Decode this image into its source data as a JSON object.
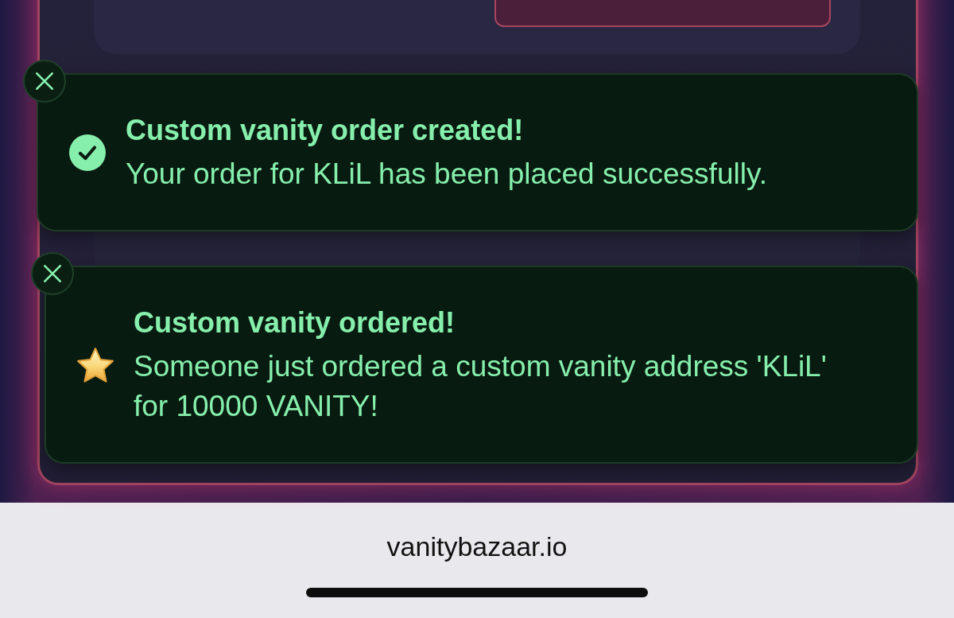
{
  "toasts": [
    {
      "kind": "success",
      "title": "Custom vanity order created!",
      "message": "Your order for KLiL has been placed successfully."
    },
    {
      "kind": "star",
      "title": "Custom vanity ordered!",
      "message": "Someone just ordered a custom vanity address 'KLiL' for 10000 VANITY!"
    }
  ],
  "browser_bar": {
    "url": "vanitybazaar.io"
  }
}
